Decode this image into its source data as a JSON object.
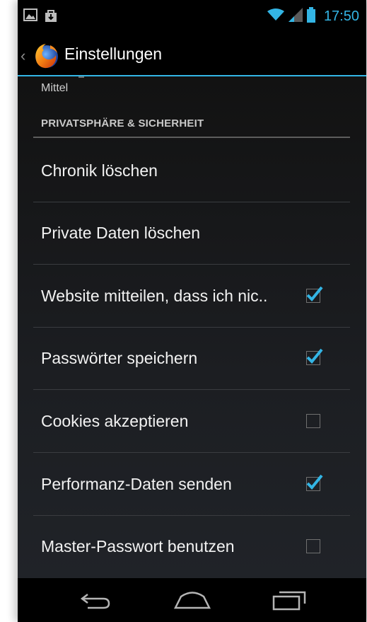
{
  "status_bar": {
    "time": "17:50",
    "accent": "#33b5e5",
    "icons": [
      "picture-icon",
      "download-icon",
      "wifi-icon",
      "signal-icon",
      "battery-icon"
    ]
  },
  "action_bar": {
    "title": "Einstellungen",
    "logo": "firefox-logo"
  },
  "settings": {
    "partial_value": "Mittel",
    "category": "PRIVATSPHÄRE & SICHERHEIT",
    "items": [
      {
        "label": "Chronik löschen",
        "checkbox": null
      },
      {
        "label": "Private Daten löschen",
        "checkbox": null
      },
      {
        "label": "Website mitteilen, dass ich nic..",
        "checkbox": true
      },
      {
        "label": "Passwörter speichern",
        "checkbox": true
      },
      {
        "label": "Cookies akzeptieren",
        "checkbox": false
      },
      {
        "label": "Performanz-Daten senden",
        "checkbox": true
      },
      {
        "label": "Master-Passwort benutzen",
        "checkbox": false
      }
    ]
  },
  "nav_bar": {
    "buttons": [
      "back-icon",
      "home-icon",
      "recent-apps-icon"
    ]
  }
}
